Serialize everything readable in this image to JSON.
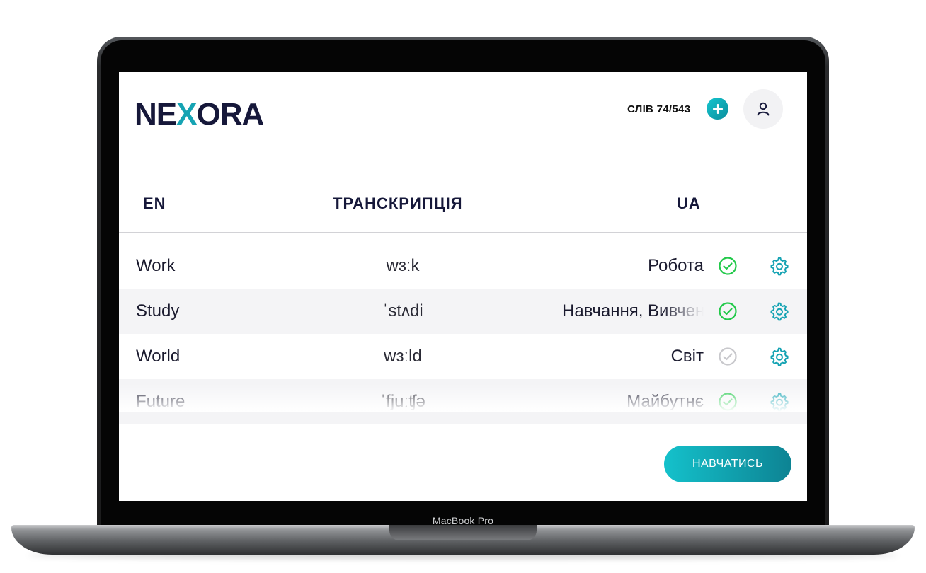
{
  "device": {
    "label": "MacBook Pro"
  },
  "header": {
    "logo_prefix": "NE",
    "logo_x": "X",
    "logo_suffix": "ORA",
    "word_counter": "СЛІВ 74/543",
    "add_icon": "plus-icon",
    "profile_icon": "user-icon"
  },
  "table": {
    "columns": [
      "EN",
      "ТРАНСКРИПЦІЯ",
      "UA"
    ],
    "rows": [
      {
        "en": "Work",
        "transcription": "wɜːk",
        "ua": "Робота",
        "learned": true
      },
      {
        "en": "Study",
        "transcription": "ˈstʌdi",
        "ua": "Навчання, Вивчення",
        "learned": true
      },
      {
        "en": "World",
        "transcription": "wɜːld",
        "ua": "Світ",
        "learned": false
      },
      {
        "en": "Future",
        "transcription": "ˈfjuːʧə",
        "ua": "Майбутнє",
        "learned": true
      }
    ]
  },
  "actions": {
    "learn_button": "НАВЧАТИСЬ"
  },
  "colors": {
    "accent": "#15a3b3",
    "learned": "#22c94a",
    "not_learned": "#c8c8cc",
    "text_dark": "#16183a"
  }
}
